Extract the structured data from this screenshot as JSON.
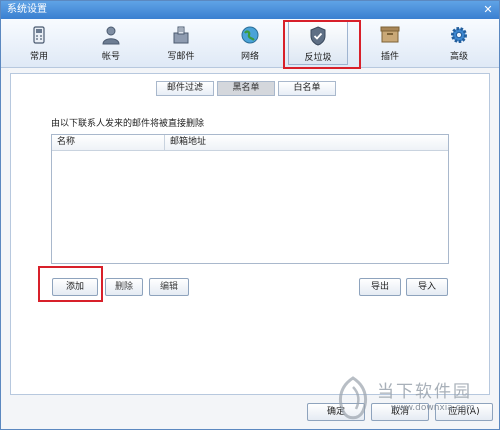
{
  "window": {
    "title": "系统设置",
    "close_glyph": "✕"
  },
  "toolbar": {
    "items": [
      {
        "label": "常用",
        "icon": "phone-icon"
      },
      {
        "label": "帐号",
        "icon": "user-icon"
      },
      {
        "label": "写邮件",
        "icon": "compose-icon"
      },
      {
        "label": "网络",
        "icon": "globe-icon"
      },
      {
        "label": "反垃圾",
        "icon": "shield-icon",
        "active": true
      },
      {
        "label": "插件",
        "icon": "box-icon"
      },
      {
        "label": "高级",
        "icon": "gear-icon"
      }
    ]
  },
  "subtabs": [
    {
      "label": "邮件过滤"
    },
    {
      "label": "黑名单",
      "selected": true
    },
    {
      "label": "白名单"
    }
  ],
  "blacklist": {
    "description": "由以下联系人发来的邮件将被直接删除",
    "columns": [
      "名称",
      "邮箱地址"
    ],
    "buttons": {
      "add": "添加",
      "delete": "删除",
      "edit": "编辑",
      "export": "导出",
      "import": "导入"
    }
  },
  "footer": {
    "ok": "确定",
    "cancel": "取消",
    "apply": "应用(A)"
  },
  "watermark": {
    "text": "当下软件园",
    "url": "www.downxia.com"
  },
  "colors": {
    "highlight": "#d8202a",
    "titlebar": "#3a7fd0"
  }
}
